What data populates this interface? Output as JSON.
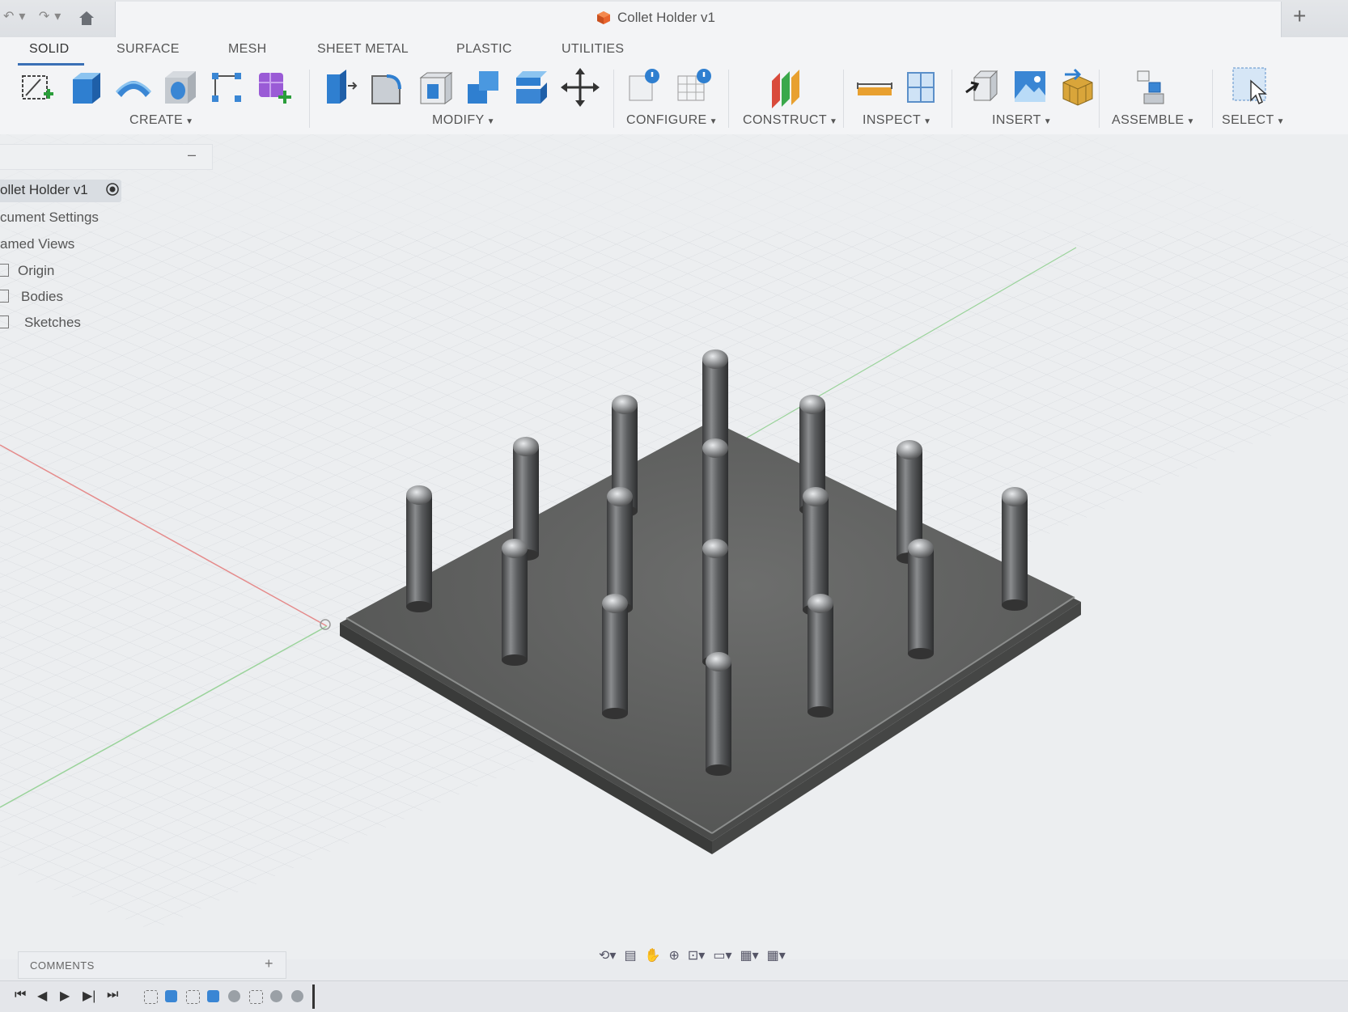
{
  "window": {
    "doc_title": "Collet Holder v1",
    "close_tab_icon": "close-icon",
    "new_tab_icon": "plus-icon",
    "home_icon": "home-icon"
  },
  "ribbon": {
    "tabs": [
      {
        "label": "SOLID",
        "active": true
      },
      {
        "label": "SURFACE",
        "active": false
      },
      {
        "label": "MESH",
        "active": false
      },
      {
        "label": "SHEET METAL",
        "active": false
      },
      {
        "label": "PLASTIC",
        "active": false
      },
      {
        "label": "UTILITIES",
        "active": false
      }
    ],
    "groups": {
      "create": "CREATE",
      "modify": "MODIFY",
      "configure": "CONFIGURE",
      "construct": "CONSTRUCT",
      "inspect": "INSPECT",
      "insert": "INSERT",
      "assemble": "ASSEMBLE",
      "select": "SELECT"
    },
    "tools": {
      "create": [
        "create-sketch-icon",
        "extrude-icon",
        "revolve-icon",
        "hole-icon",
        "rectangular-pattern-icon",
        "create-form-icon"
      ],
      "modify": [
        "press-pull-icon",
        "fillet-icon",
        "shell-icon",
        "combine-icon",
        "offset-face-icon",
        "move-icon"
      ],
      "configure": [
        "configure-icon",
        "configure-table-icon"
      ],
      "construct": [
        "offset-plane-icon"
      ],
      "inspect": [
        "measure-icon",
        "section-analysis-icon"
      ],
      "insert": [
        "insert-derive-icon",
        "decal-icon",
        "insert-mesh-icon"
      ],
      "assemble": [
        "new-component-icon"
      ],
      "select": [
        "select-icon"
      ]
    }
  },
  "browser": {
    "collapse_label": "–",
    "root": "ollet Holder v1",
    "items": [
      "cument Settings",
      "amed Views",
      "Origin",
      "Bodies",
      "Sketches"
    ]
  },
  "bottom": {
    "comments_label": "COMMENTS",
    "comments_add": "+"
  },
  "colors": {
    "accent": "#3a6fb5",
    "model_base": "#5a5b5a",
    "grid_line": "#cfd2d6",
    "x_axis": "#e07a7a",
    "z_axis": "#8fd48f"
  }
}
